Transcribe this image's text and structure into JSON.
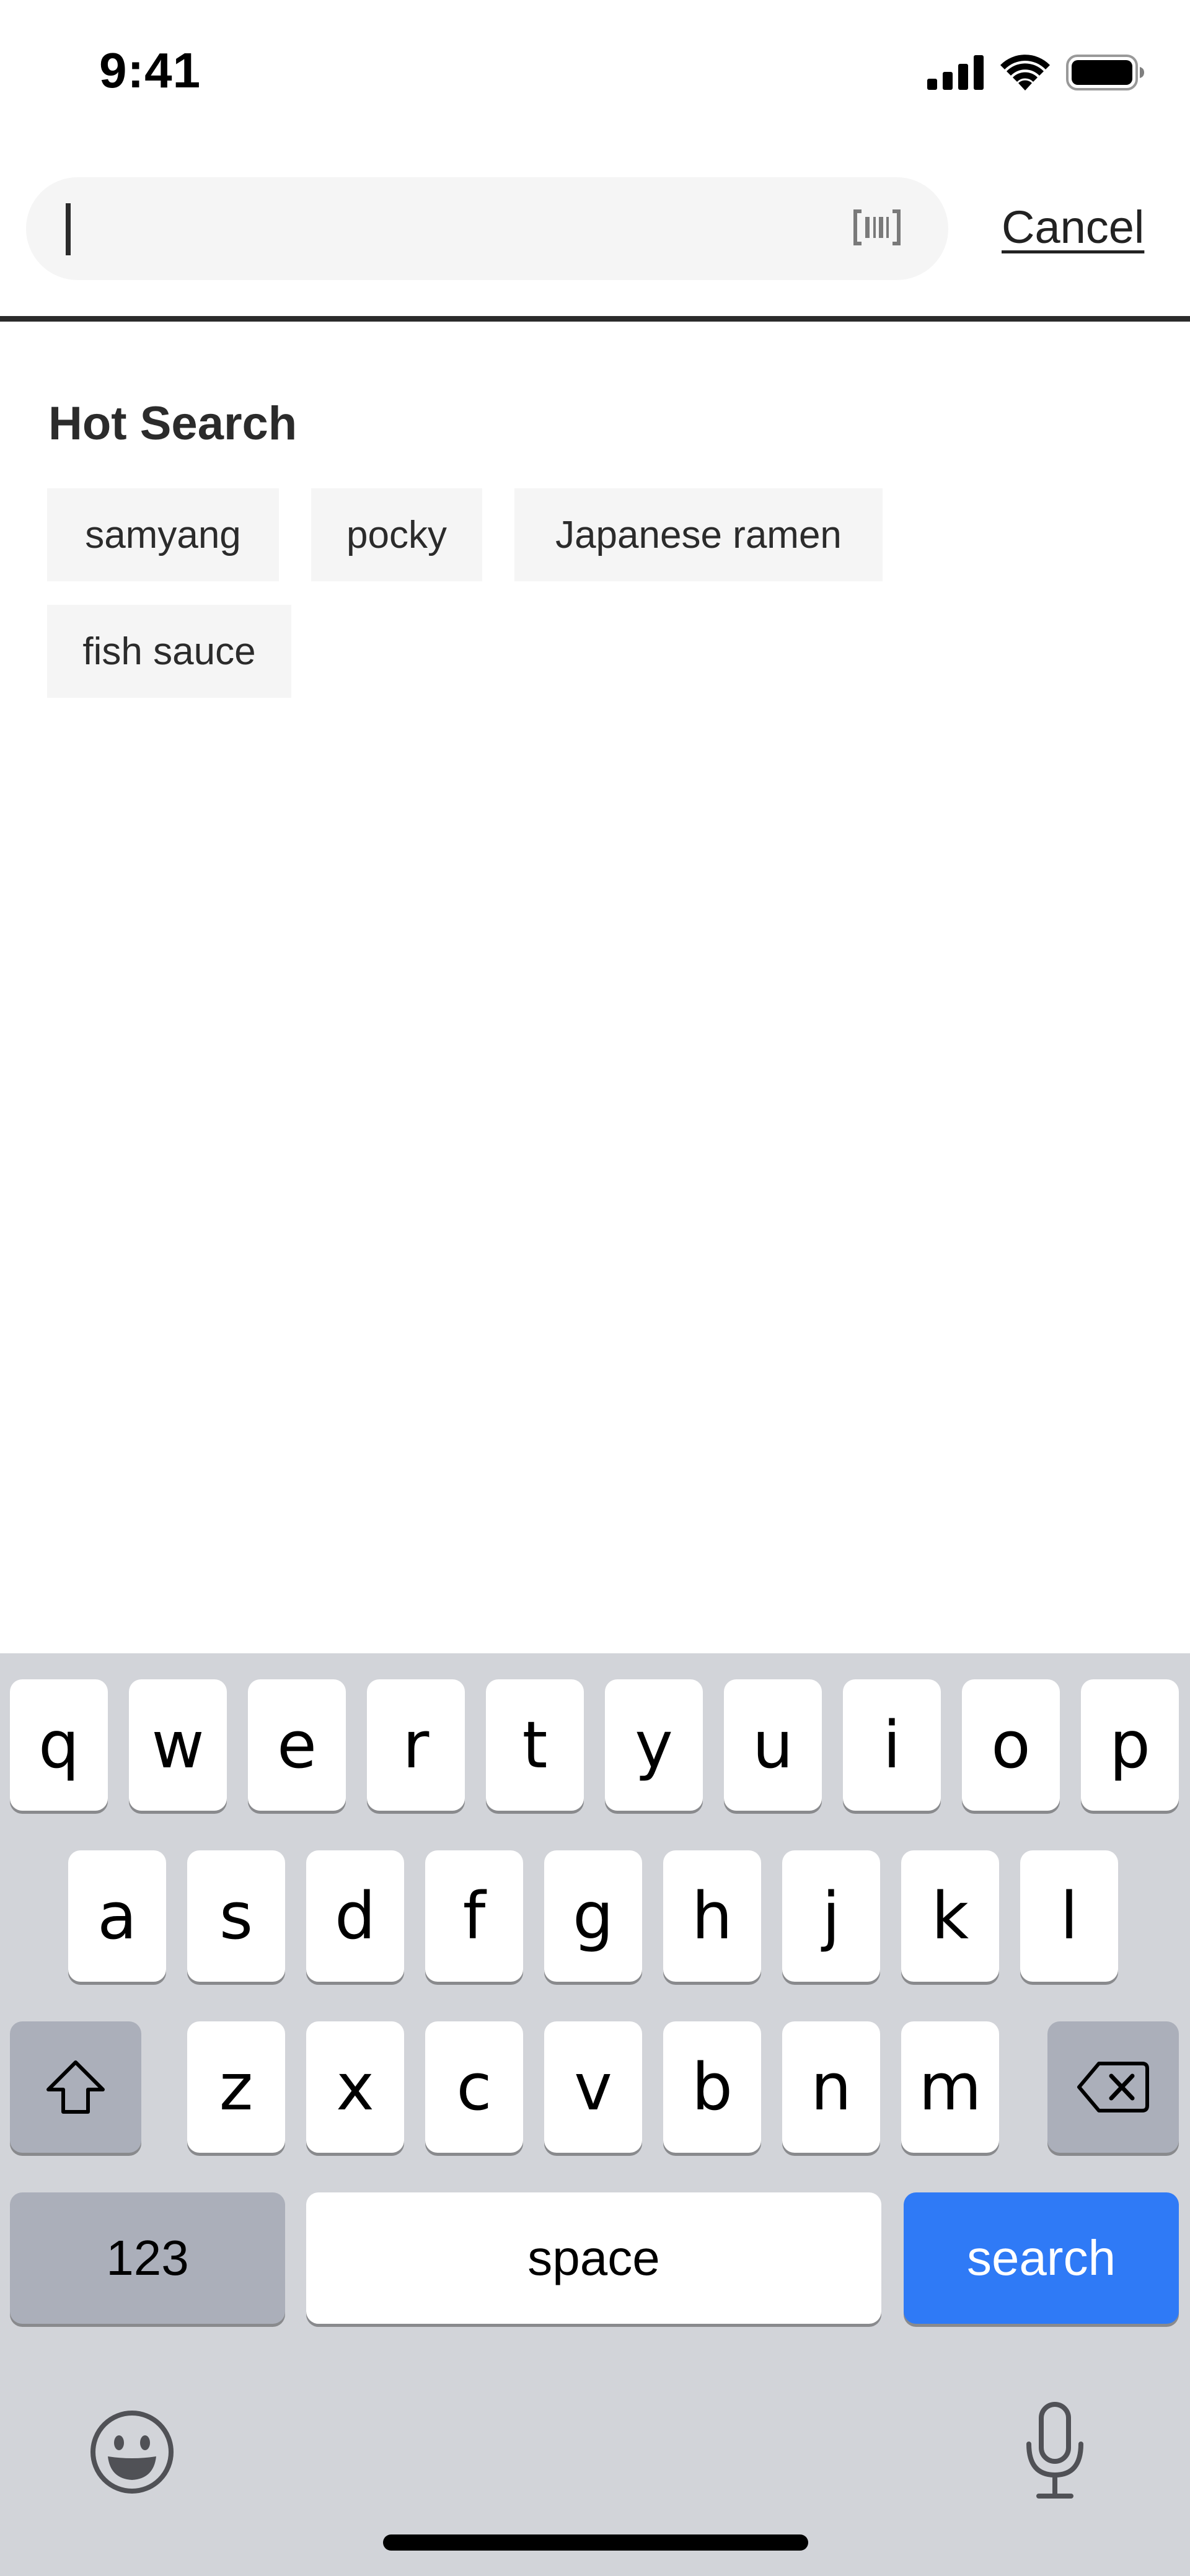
{
  "status_bar": {
    "time": "9:41",
    "icons": [
      "cellular-signal-icon",
      "wifi-icon",
      "battery-icon"
    ]
  },
  "search": {
    "value": "",
    "placeholder": "",
    "scan_icon": "barcode-scan-icon",
    "cancel_label": "Cancel"
  },
  "hot_search": {
    "title": "Hot Search",
    "items": [
      "samyang",
      "pocky",
      "Japanese ramen",
      "fish sauce"
    ]
  },
  "keyboard": {
    "row1": [
      "q",
      "w",
      "e",
      "r",
      "t",
      "y",
      "u",
      "i",
      "o",
      "p"
    ],
    "row2": [
      "a",
      "s",
      "d",
      "f",
      "g",
      "h",
      "j",
      "k",
      "l"
    ],
    "row3": [
      "z",
      "x",
      "c",
      "v",
      "b",
      "n",
      "m"
    ],
    "shift_icon": "shift-icon",
    "delete_icon": "backspace-icon",
    "numbers_label": "123",
    "space_label": "space",
    "search_label": "search",
    "emoji_icon": "emoji-icon",
    "mic_icon": "microphone-icon",
    "search_key_color": "#2f7af6"
  }
}
